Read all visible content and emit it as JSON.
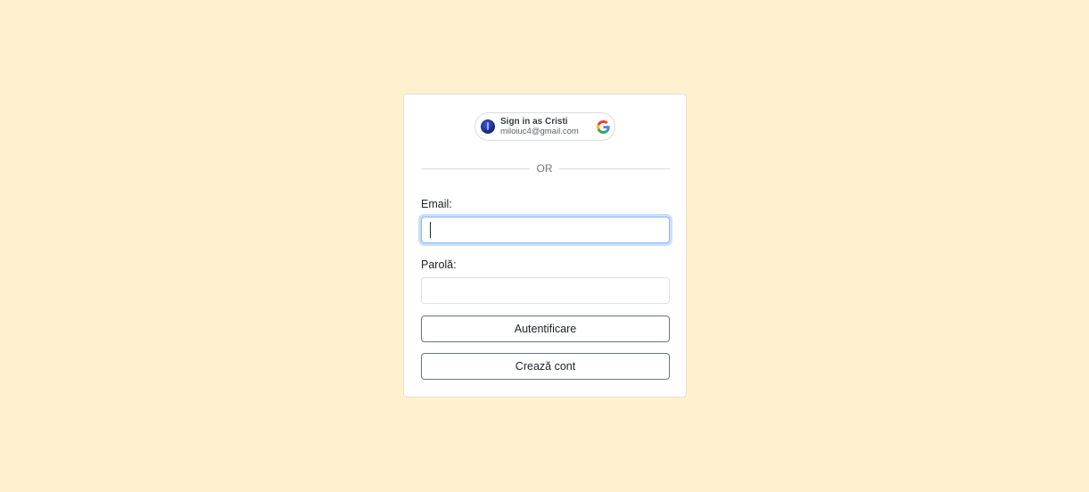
{
  "google_button": {
    "title": "Sign in as Cristi",
    "email": "miloiuc4@gmail.com"
  },
  "divider": {
    "text": "OR"
  },
  "form": {
    "email_label": "Email:",
    "email_value": "",
    "password_label": "Parolă:",
    "password_value": "",
    "login_button": "Autentificare",
    "create_account_button": "Crează cont"
  },
  "colors": {
    "page_background": "#fff1cf",
    "card_background": "#ffffff",
    "focus_ring": "#86b7fe",
    "button_border": "#6c757d"
  }
}
